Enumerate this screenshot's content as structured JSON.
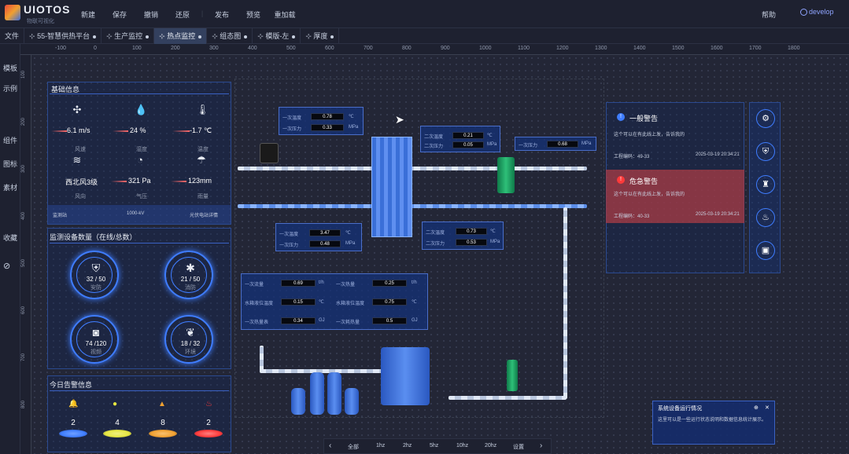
{
  "app": {
    "logo_title": "UIOTOS",
    "logo_sub": "物联可视化"
  },
  "menu": [
    "新建",
    "保存",
    "撤销",
    "还原",
    "发布",
    "预览",
    "重加载"
  ],
  "header": {
    "help": "帮助",
    "user": "develop"
  },
  "tabs": [
    {
      "label": "文件"
    },
    {
      "label": "55-智慧供热平台"
    },
    {
      "label": "生产监控"
    },
    {
      "label": "热点监控"
    },
    {
      "label": "组态图"
    },
    {
      "label": "模版-左"
    },
    {
      "label": "厚度"
    }
  ],
  "lefttools": [
    "文件",
    "模板",
    "示例",
    "组件",
    "图标",
    "素材",
    "收藏"
  ],
  "ruler_top": [
    "-100",
    "0",
    "100",
    "200",
    "300",
    "400",
    "500",
    "600",
    "700",
    "800",
    "900",
    "1000",
    "1100",
    "1200",
    "1300",
    "1400",
    "1500",
    "1600",
    "1700",
    "1800"
  ],
  "ruler_left": [
    "100",
    "200",
    "300",
    "400",
    "500",
    "600",
    "700",
    "800"
  ],
  "basic_info": {
    "title": "基础信息",
    "metrics": [
      {
        "icon": "fan-icon",
        "value": "6.1 m/s",
        "label": "风速"
      },
      {
        "icon": "droplet-icon",
        "value": "24 %",
        "label": "湿度"
      },
      {
        "icon": "thermometer-icon",
        "value": "-1.7 ℃",
        "label": "温度"
      },
      {
        "icon": "wind-icon",
        "value": "西北风3级",
        "label": "风向"
      },
      {
        "icon": "gauge-icon",
        "value": "321 Pa",
        "label": "气压"
      },
      {
        "icon": "rain-icon",
        "value": "123mm",
        "label": "雨量"
      }
    ],
    "footer": [
      "监测站",
      "1000-kV",
      "光伏电站详情"
    ]
  },
  "monitor": {
    "title": "监测设备数量（在线/总数）",
    "rings": [
      {
        "icon": "shield-icon",
        "value": "32 / 50",
        "label": "安防"
      },
      {
        "icon": "bug-icon",
        "value": "21 / 50",
        "label": "消防"
      },
      {
        "icon": "camera-icon",
        "value": "74 /120",
        "label": "视频"
      },
      {
        "icon": "leaf-icon",
        "value": "18 / 32",
        "label": "环境"
      }
    ]
  },
  "alarms": {
    "title": "今日告警信息",
    "items": [
      {
        "icon": "bell-icon",
        "value": "2",
        "color": "#3f7dff"
      },
      {
        "icon": "alert-circle-icon",
        "value": "4",
        "color": "#e6e640"
      },
      {
        "icon": "warning-icon",
        "value": "8",
        "color": "#f0a030"
      },
      {
        "icon": "siren-icon",
        "value": "2",
        "color": "#ff3a3a"
      }
    ]
  },
  "scada": {
    "box1": {
      "rows": [
        {
          "label": "一次温度",
          "value": "0.78",
          "unit": "℃"
        },
        {
          "label": "一次压力",
          "value": "0.33",
          "unit": "MPa"
        }
      ]
    },
    "box2": {
      "rows": [
        {
          "label": "二次温度",
          "value": "0.21",
          "unit": "℃"
        },
        {
          "label": "二次压力",
          "value": "0.05",
          "unit": "MPa"
        }
      ]
    },
    "box3": {
      "rows": [
        {
          "label": "一次压力",
          "value": "0.68",
          "unit": "MPa"
        }
      ]
    },
    "box4": {
      "rows": [
        {
          "label": "一次温度",
          "value": "3.47",
          "unit": "℃"
        },
        {
          "label": "一次压力",
          "value": "0.48",
          "unit": "MPa"
        }
      ]
    },
    "box5": {
      "rows": [
        {
          "label": "二次温度",
          "value": "0.73",
          "unit": "℃"
        },
        {
          "label": "二次压力",
          "value": "0.53",
          "unit": "MPa"
        }
      ]
    },
    "box6": {
      "rows": [
        {
          "label": "一次流量",
          "value": "0.69",
          "unit": "t/h",
          "label2": "一次热量",
          "value2": "0.25",
          "unit2": "t/h"
        },
        {
          "label": "水箱液位温度",
          "value": "0.15",
          "unit": "℃",
          "label2": "水箱液位温度",
          "value2": "0.75",
          "unit2": "℃"
        },
        {
          "label": "一次热量表",
          "value": "0.34",
          "unit": "GJ",
          "label2": "一次耗热量",
          "value2": "0.5",
          "unit2": "GJ"
        }
      ]
    }
  },
  "notices": {
    "first": {
      "title": "一般警告",
      "text": "这个可以在有此线上发，告诉我的",
      "meta_left": "工程编码：49-33",
      "meta_right": "2025-03-19 20:34:21"
    },
    "second": {
      "title": "危急警告",
      "text": "这个可以在有此线上发，告诉我的",
      "meta_left": "工程编码：40-33",
      "meta_right": "2025-03-19 20:34:21"
    }
  },
  "side_icons": [
    "pump-icon",
    "shield-icon",
    "tower-icon",
    "fire-icon",
    "monitor-icon"
  ],
  "popup": {
    "title": "系统设备运行情况",
    "text": "这里可以是一些运行状态说明和数据信息统计展示。"
  },
  "bottombar": [
    "全部",
    "1hz",
    "2hz",
    "5hz",
    "10hz",
    "20hz",
    "设置"
  ]
}
